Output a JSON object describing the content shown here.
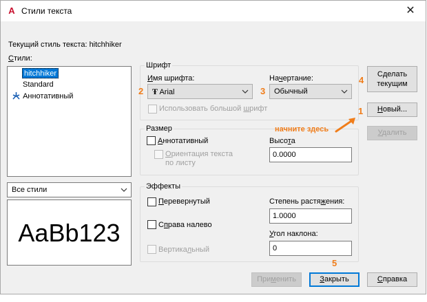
{
  "window": {
    "title": "Стили текста",
    "logo_letter": "A",
    "close_glyph": "✕"
  },
  "current_style": {
    "label": "Текущий стиль текста:",
    "value": "hitchhiker"
  },
  "styles": {
    "label_prefix": "С",
    "label_rest": "тили:",
    "items": [
      {
        "label": "hitchhiker",
        "selected": true,
        "icon": ""
      },
      {
        "label": "Standard",
        "selected": false,
        "icon": ""
      },
      {
        "label": "Аннотативный",
        "selected": false,
        "icon": "annotative-icon"
      }
    ],
    "filter_value": "Все стили",
    "preview_text": "AaBb123"
  },
  "font": {
    "group_title": "Шрифт",
    "name_label_prefix": "И",
    "name_label_rest": "мя шрифта:",
    "name_value": "Arial",
    "name_icon": "truetype-icon",
    "name_icon_glyph": "Ŧ",
    "style_label_pre": "На",
    "style_label_u": "ч",
    "style_label_post": "ертание:",
    "style_value": "Обычный",
    "bigfont_pre": "Использовать большой ",
    "bigfont_u": "ш",
    "bigfont_post": "рифт"
  },
  "size": {
    "group_title": "Размер",
    "annotative_pre": "",
    "annotative_u": "А",
    "annotative_post": "ннотативный",
    "orient_u": "О",
    "orient_line1_rest": "риентация текста",
    "orient_line2": "по листу",
    "height_pre": "Высо",
    "height_u": "т",
    "height_post": "а",
    "height_value": "0.0000"
  },
  "effects": {
    "group_title": "Эффекты",
    "upside_u": "П",
    "upside_rest": "еревернутый",
    "backwards_pre": "С",
    "backwards_u": "п",
    "backwards_post": "рава налево",
    "vertical_pre": "Вертика",
    "vertical_u": "л",
    "vertical_post": "ьный",
    "width_pre": "Степень растя",
    "width_u": "ж",
    "width_post": "ения:",
    "width_value": "1.0000",
    "oblique_pre": "",
    "oblique_u": "У",
    "oblique_post": "гол наклона:",
    "oblique_value": "0"
  },
  "buttons": {
    "set_current_line1": "Сделать",
    "set_current_line2": "текущим",
    "new_u": "Н",
    "new_rest": "овый...",
    "delete_u": "У",
    "delete_rest": "далить",
    "apply_pre": "При",
    "apply_u": "м",
    "apply_post": "енить",
    "close_u": "З",
    "close_rest": "акрыть",
    "help_u": "С",
    "help_rest": "правка"
  },
  "annotations": {
    "step1": "1",
    "step2": "2",
    "step3": "3",
    "step4": "4",
    "step5": "5",
    "hint": "начните здесь"
  },
  "colors": {
    "accent_orange": "#f07d1a",
    "selection_blue": "#0078d7",
    "logo_red": "#c8102e"
  }
}
